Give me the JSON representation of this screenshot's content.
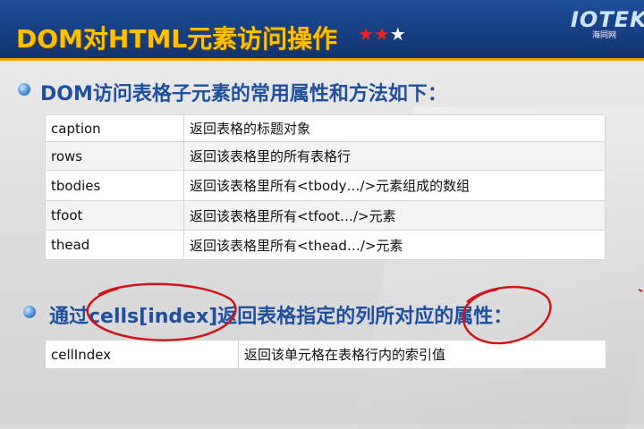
{
  "header": {
    "title": "DOM对HTML元素访问操作",
    "stars": "★★★",
    "logo_text": "IOTEK",
    "logo_sub": "海同网"
  },
  "section1": {
    "heading": "DOM访问表格子元素的常用属性和方法如下：",
    "rows": [
      {
        "name": "caption",
        "desc": "返回表格的标题对象"
      },
      {
        "name": "rows",
        "desc": "返回该表格里的所有表格行"
      },
      {
        "name": "tbodies",
        "desc": "返回该表格里所有<tbody…/>元素组成的数组"
      },
      {
        "name": "tfoot",
        "desc": "返回该表格里所有<tfoot…/>元素"
      },
      {
        "name": "thead",
        "desc": "返回该表格里所有<thead…/>元素"
      }
    ]
  },
  "section2": {
    "heading": "通过cells[index]返回表格指定的列所对应的属性：",
    "rows": [
      {
        "name": "cellIndex",
        "desc": "返回该单元格在表格行内的索引值"
      }
    ]
  },
  "colors": {
    "header_bg": "#1a4589",
    "title": "#ffc000",
    "heading": "#1f4f9f",
    "annotation": "#d0141b"
  }
}
